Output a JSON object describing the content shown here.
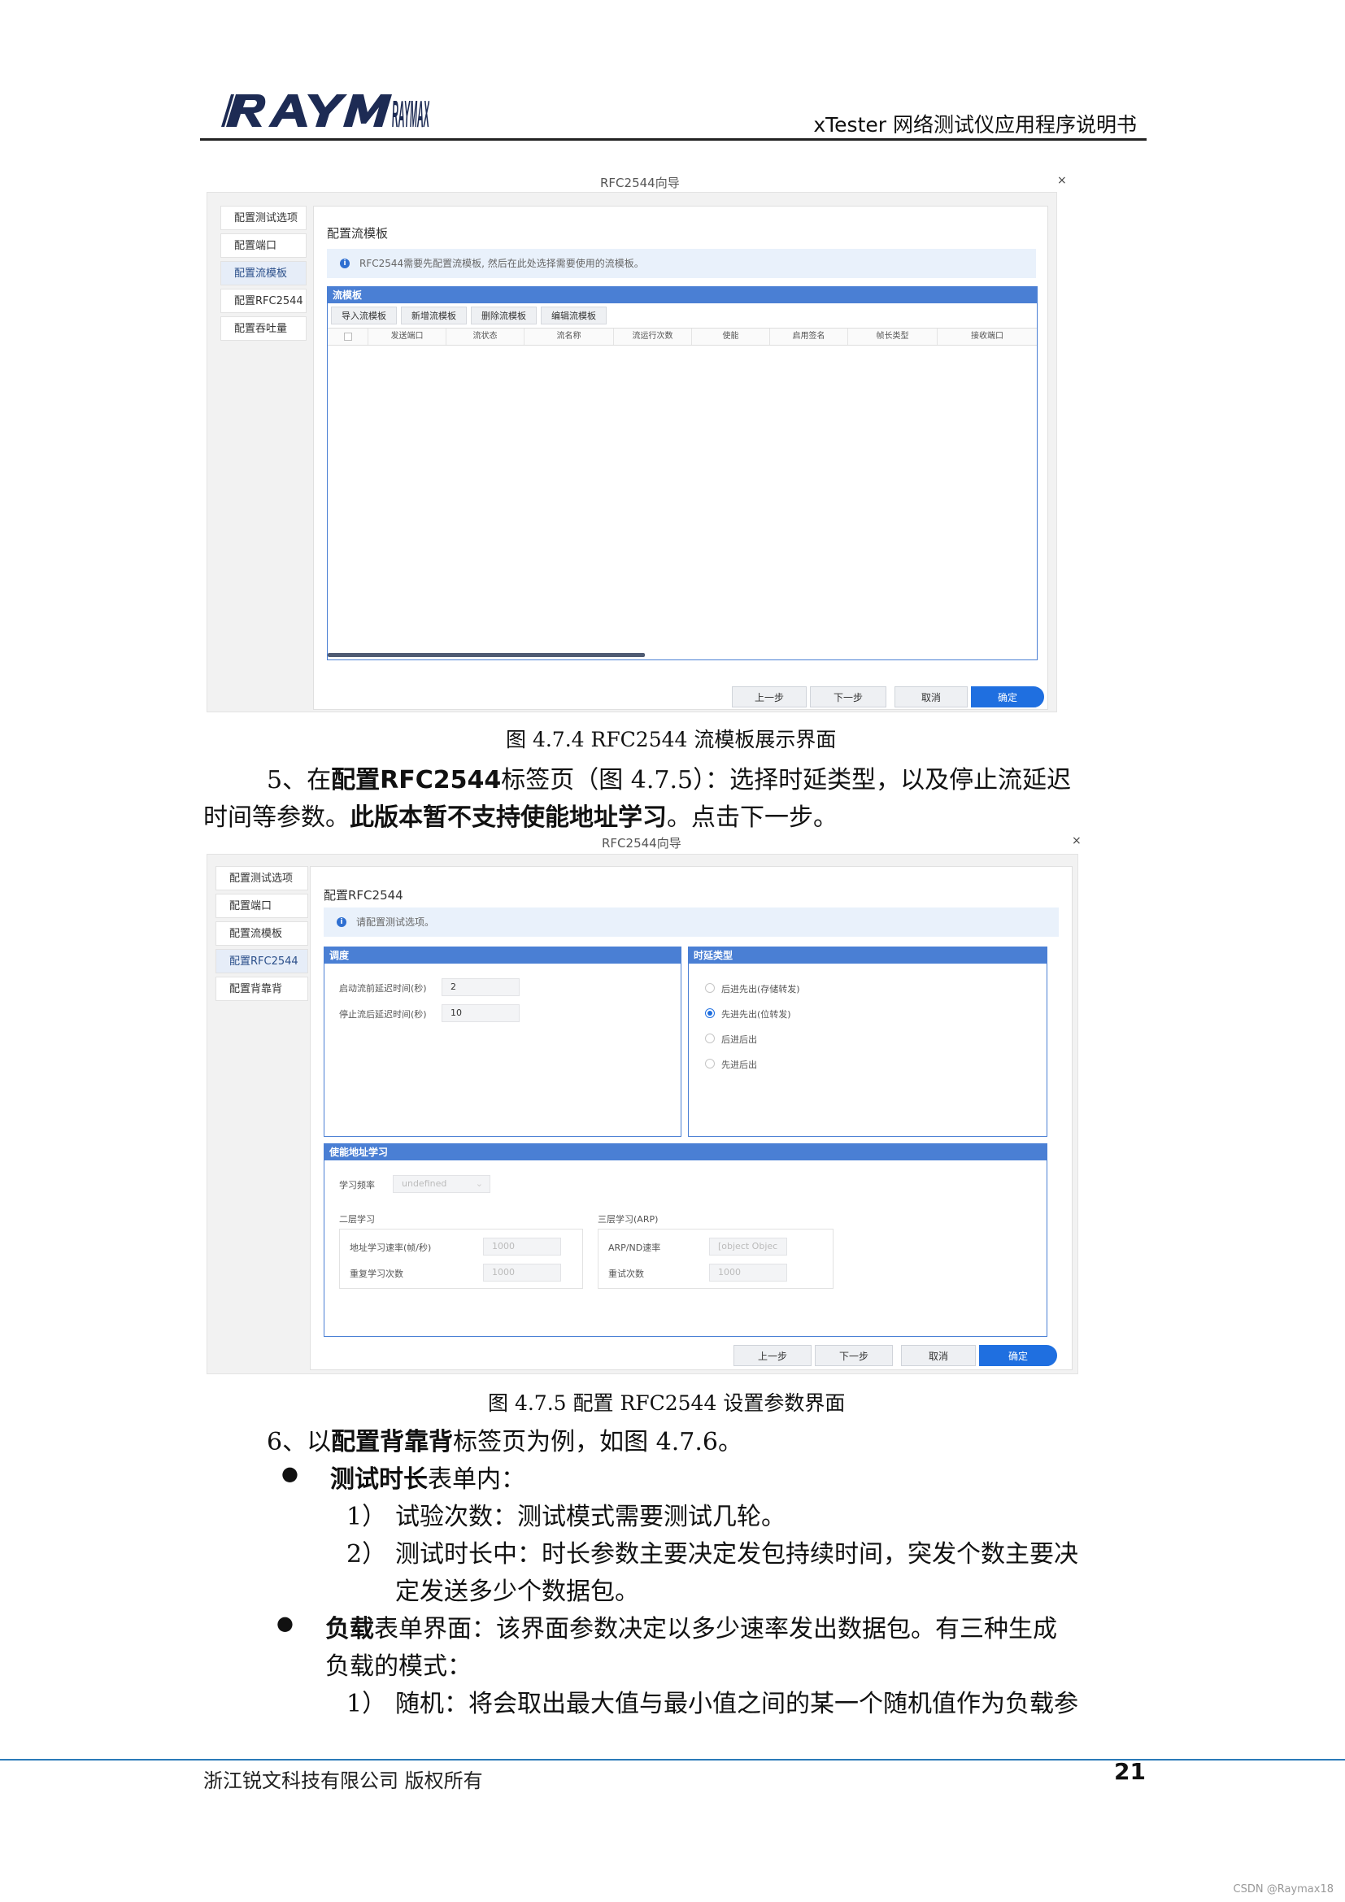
{
  "header": {
    "logo": "RAYMAX",
    "doc_title": "xTester 网络测试仪应用程序说明书"
  },
  "figure1": {
    "window_title": "RFC2544向导",
    "close": "×",
    "nav": [
      "配置测试选项",
      "配置端口",
      "配置流模板",
      "配置RFC2544",
      "配置吞吐量"
    ],
    "section_title": "配置流模板",
    "info": "RFC2544需要先配置流模板, 然后在此处选择需要使用的流模板。",
    "panel_title": "流模板",
    "toolbar": [
      "导入流模板",
      "新增流模板",
      "删除流模板",
      "编辑流模板"
    ],
    "columns": [
      "发送端口",
      "流状态",
      "流名称",
      "流运行次数",
      "使能",
      "启用签名",
      "帧长类型",
      "接收端口"
    ],
    "buttons": {
      "prev": "上一步",
      "next": "下一步",
      "cancel": "取消",
      "ok": "确定"
    },
    "caption": "图 4.7.4 RFC2544 流模板展示界面"
  },
  "paragraph1": {
    "line1_a": "5、在",
    "line1_b": "配置",
    "line1_c": "RFC2544",
    "line1_d": "标签页（图 4.7.5）：选择时延类型，以及停止流延迟",
    "line2_a": "时间等参数。",
    "line2_b": "此版本暂不支持使能地址学习",
    "line2_c": "。点击下一步。"
  },
  "figure2": {
    "window_title": "RFC2544向导",
    "close": "×",
    "nav": [
      "配置测试选项",
      "配置端口",
      "配置流模板",
      "配置RFC2544",
      "配置背靠背"
    ],
    "section_title": "配置RFC2544",
    "info": "请配置测试选项。",
    "schedule": {
      "title": "调度",
      "fields": [
        {
          "label": "启动流前延迟时间(秒)",
          "value": "2"
        },
        {
          "label": "停止流后延迟时间(秒)",
          "value": "10"
        }
      ]
    },
    "latency": {
      "title": "时延类型",
      "options": [
        "后进先出(存储转发)",
        "先进先出(位转发)",
        "后进后出",
        "先进后出"
      ],
      "selected_index": 1
    },
    "learning": {
      "title": "使能地址学习",
      "freq_label": "学习频率",
      "freq_value": "undefined",
      "l2_title": "二层学习",
      "l2_rate_label": "地址学习速率(帧/秒)",
      "l2_rate_value": "1000",
      "l2_repeat_label": "重复学习次数",
      "l2_repeat_value": "1000",
      "l3_title": "三层学习(ARP)",
      "l3_rate_label": "ARP/ND速率",
      "l3_rate_value": "[object Objec",
      "l3_retry_label": "重试次数",
      "l3_retry_value": "1000"
    },
    "buttons": {
      "prev": "上一步",
      "next": "下一步",
      "cancel": "取消",
      "ok": "确定"
    },
    "caption": "图  4.7.5 配置 RFC2544 设置参数界面"
  },
  "paragraph2": {
    "a": "6、以",
    "b": "配置背靠背",
    "c": "标签页为例，如图 4.7.6。"
  },
  "bullets": [
    {
      "bold": "测试时长",
      "text": "表单内：",
      "items": [
        {
          "num": "1）",
          "text": "试验次数：测试模式需要测试几轮。"
        },
        {
          "num": "2）",
          "text": "测试时长中：时长参数主要决定发包持续时间，突发个数主要决",
          "cont": "定发送多少个数据包。"
        }
      ]
    },
    {
      "bold": "负载",
      "text": "表单界面：该界面参数决定以多少速率发出数据包。有三种生成",
      "cont": "负载的模式：",
      "items": [
        {
          "num": "1）",
          "text": "随机：将会取出最大值与最小值之间的某一个随机值作为负载参"
        }
      ]
    }
  ],
  "footer": {
    "company": "浙江锐文科技有限公司  版权所有",
    "page": "21",
    "watermark": "CSDN @Raymax18"
  }
}
